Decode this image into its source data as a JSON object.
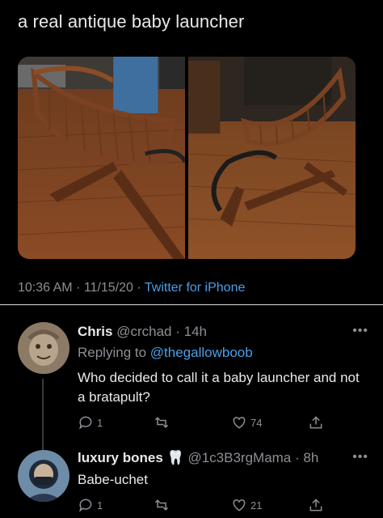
{
  "tweet": {
    "text": "a real antique baby launcher",
    "time": "10:36 AM",
    "sep1": "·",
    "date": "11/15/20",
    "sep2": "·",
    "source": "Twitter for iPhone"
  },
  "media": {
    "images": [
      {
        "alt_name": "antique-cradle-photo-1"
      },
      {
        "alt_name": "antique-cradle-photo-2"
      }
    ]
  },
  "replies": [
    {
      "name": "Chris",
      "handle": "@crchad",
      "sep": "·",
      "time": "14h",
      "replying_prefix": "Replying to",
      "replying_to": "@thegallowboob",
      "text": "Who decided to call it a baby launcher and not a bratapult?",
      "more": "•••",
      "reply_count": "1",
      "retweet_count": "",
      "like_count": "74"
    },
    {
      "name": "luxury bones",
      "emoji": "🦷",
      "handle": "@1c3B3rgMama",
      "sep": "·",
      "time": "8h",
      "text": "Babe-uchet",
      "more": "•••",
      "reply_count": "1",
      "retweet_count": "",
      "like_count": "21"
    }
  ],
  "icons": {
    "reply": "speech-bubble-icon",
    "retweet": "retweet-icon",
    "like": "heart-icon",
    "share": "share-icon"
  }
}
